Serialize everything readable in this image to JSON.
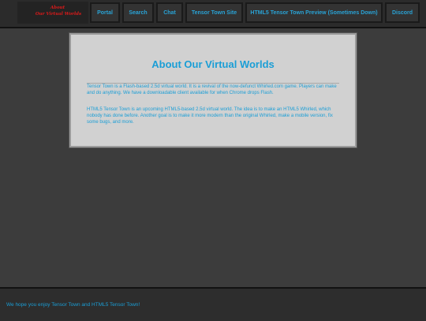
{
  "logo": {
    "line1": "About",
    "line2": "Our Virtual Worlds"
  },
  "nav": {
    "items": [
      {
        "label": "Portal"
      },
      {
        "label": "Search"
      },
      {
        "label": "Chat"
      },
      {
        "label": "Tensor Town Site"
      },
      {
        "label": "HTML5 Tensor Town Preview (Sometimes Down)"
      },
      {
        "label": "Discord"
      }
    ]
  },
  "main": {
    "title": "About Our Virtual Worlds",
    "paragraphs": [
      "Tensor Town is a Flash-based 2.5d virtual world. It is a revival of the now-defunct Whirled.com game. Players can make and do anything. We have a downloadable client available for when Chrome drops Flash.",
      "HTML5 Tensor Town is an upcoming HTML5-based 2.5d virtual world. The idea is to make an HTML5 Whirled, which nobody has done before. Another goal is to make it more modern than the original Whirled, make a mobile version, fix some bugs, and more."
    ]
  },
  "footer": {
    "text": "We hope you enjoy Tensor Town and HTML5 Tensor Town!"
  },
  "colors": {
    "accent": "#1a9ed6",
    "logo_red": "#d81a1a",
    "panel_bg": "#d1d1d1",
    "page_bg": "#3c3c3c"
  }
}
